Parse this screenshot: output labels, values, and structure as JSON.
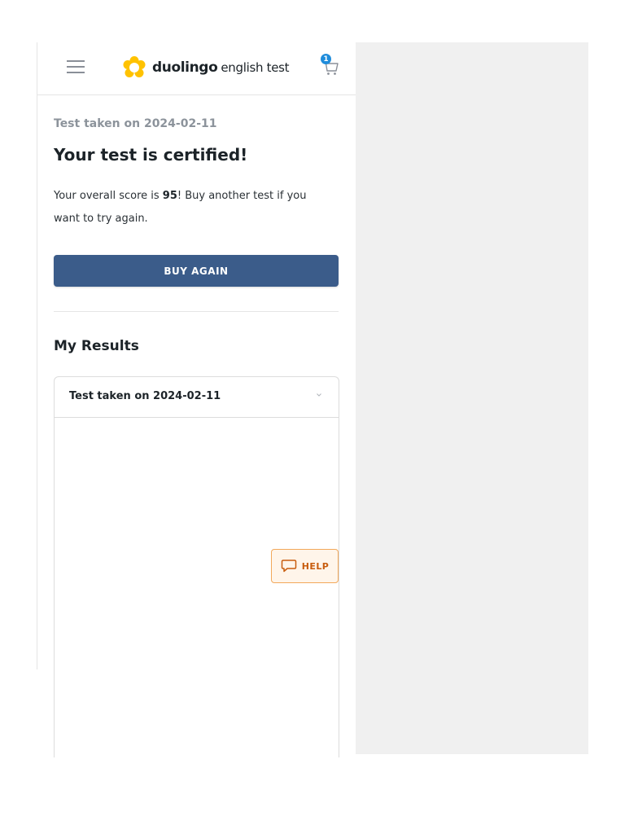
{
  "header": {
    "menu_icon": "hamburger-icon",
    "logo_word": "duolingo",
    "logo_sub": "english test",
    "cart_icon": "cart-icon",
    "cart_count": "1"
  },
  "status": {
    "taken_label": "Test taken on 2024-02-11",
    "certified_title": "Your test is certified!",
    "score_prefix": "Your overall score is ",
    "score_value": "95",
    "score_suffix": "! Buy another test if you want to try again."
  },
  "actions": {
    "buy_again_label": "BUY AGAIN"
  },
  "results": {
    "section_title": "My Results",
    "items": [
      {
        "label": "Test taken on 2024-02-11",
        "expanded": true
      }
    ]
  },
  "help": {
    "label": "HELP",
    "icon": "chat-bubble-icon"
  },
  "colors": {
    "primary_button": "#3b5c8a",
    "help_accent": "#c85d0e",
    "cart_badge": "#1f8cdb",
    "logo_yellow": "#ffc200"
  }
}
